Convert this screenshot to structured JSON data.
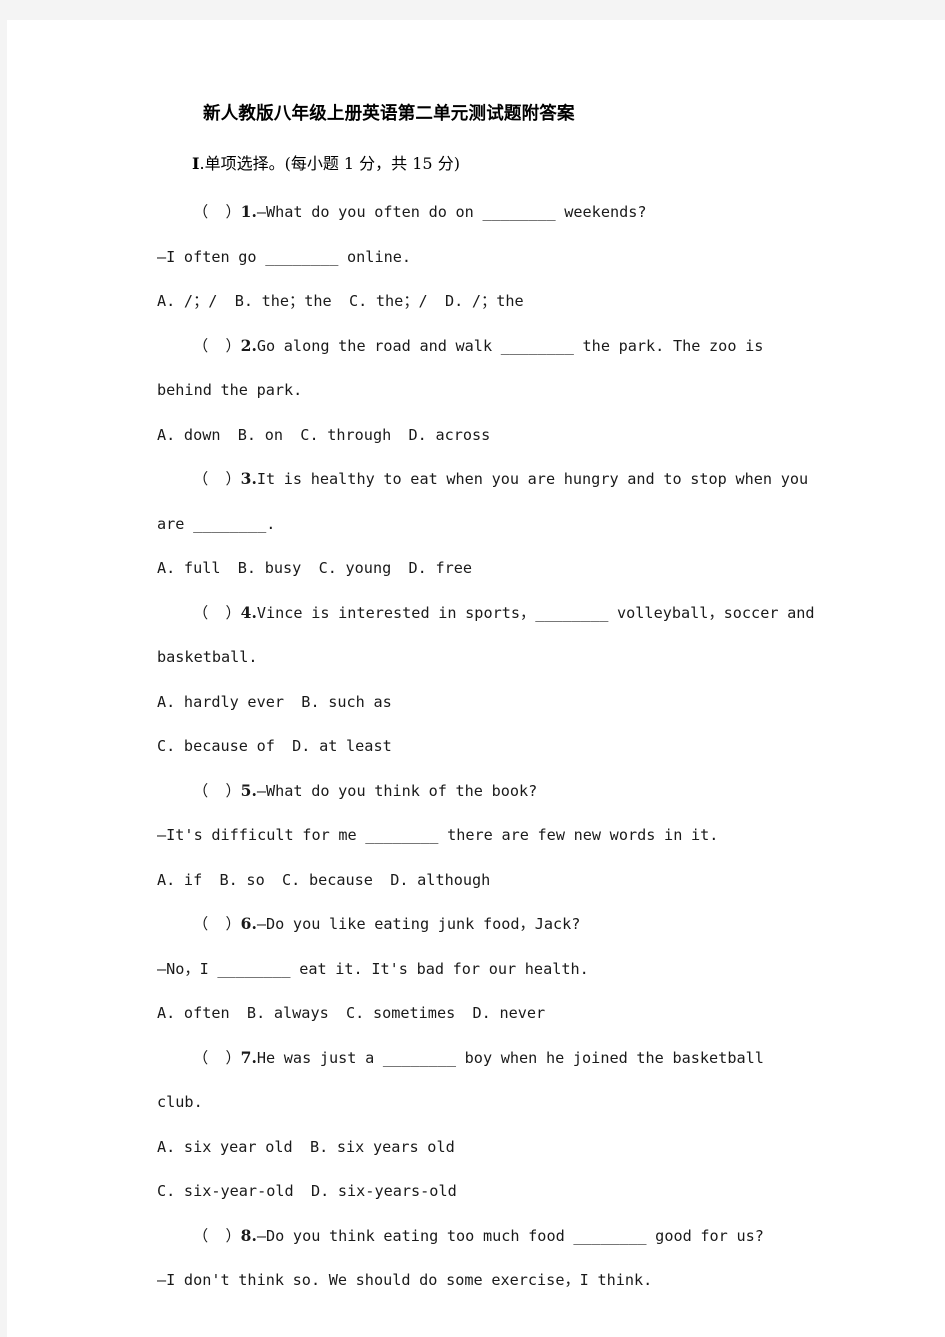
{
  "document": {
    "title": "新人教版八年级上册英语第二单元测试题附答案",
    "section": {
      "numeral": "Ⅰ",
      "label": ".单项选择。(每小题 1 分，共 15 分)"
    }
  },
  "questions": [
    {
      "marker": "（  ）",
      "number": "1.",
      "lines": [
        "—What do you often do on ________ weekends?",
        "—I often go ________ online.",
        "A. /；/  B. the；the  C. the；/  D. /；the"
      ]
    },
    {
      "marker": "（  ）",
      "number": "2.",
      "lines": [
        "Go along the road and walk ________ the park. The zoo is behind the park.",
        "A. down  B. on  C. through  D. across"
      ]
    },
    {
      "marker": "（  ）",
      "number": "3.",
      "lines": [
        "It is healthy to eat when you are hungry and to stop when you are ________.",
        "A. full  B. busy  C. young  D. free"
      ]
    },
    {
      "marker": "（  ）",
      "number": "4.",
      "lines": [
        "Vince is interested in sports，________ volleyball，soccer and basketball.",
        "A. hardly ever  B. such as",
        "C. because of  D. at least"
      ]
    },
    {
      "marker": "（  ）",
      "number": "5.",
      "lines": [
        "—What do you think of the book?",
        "—It's difficult for me ________ there are few new words in it.",
        "A. if  B. so  C. because  D. although"
      ]
    },
    {
      "marker": "（  ）",
      "number": "6.",
      "lines": [
        "—Do you like eating junk food，Jack?",
        "—No，I ________ eat it. It's bad for our health.",
        "A. often  B. always  C. sometimes  D. never"
      ]
    },
    {
      "marker": "（  ）",
      "number": "7.",
      "lines": [
        "He was just a ________ boy when he joined the basketball club.",
        "A. six year old  B. six years old",
        "C. six-year-old  D. six-years-old"
      ]
    },
    {
      "marker": "（  ）",
      "number": "8.",
      "lines": [
        "—Do you think eating too much food ________ good for us?",
        "—I don't think so. We should do some exercise，I think."
      ]
    }
  ]
}
